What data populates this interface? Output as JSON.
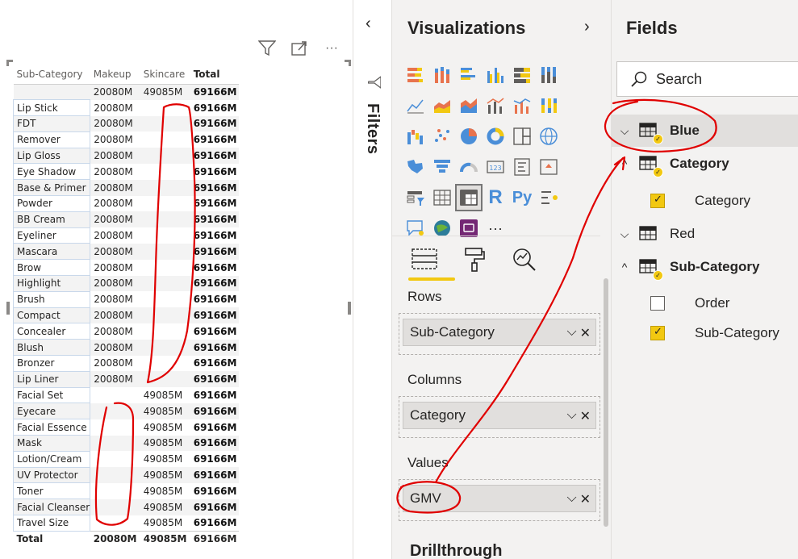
{
  "visual_header": {
    "icons": [
      "filter-icon",
      "focus-mode-icon",
      "more-options-icon"
    ],
    "more_label": "···"
  },
  "matrix": {
    "columns": [
      "Sub-Category",
      "Makeup",
      "Skincare",
      "Total"
    ],
    "rows": [
      {
        "label": "",
        "makeup": "20080M",
        "skincare": "49085M",
        "total": "69166M"
      },
      {
        "label": "Lip Stick",
        "makeup": "20080M",
        "skincare": "",
        "total": "69166M"
      },
      {
        "label": "FDT",
        "makeup": "20080M",
        "skincare": "",
        "total": "69166M"
      },
      {
        "label": "Remover",
        "makeup": "20080M",
        "skincare": "",
        "total": "69166M"
      },
      {
        "label": "Lip Gloss",
        "makeup": "20080M",
        "skincare": "",
        "total": "69166M"
      },
      {
        "label": "Eye Shadow",
        "makeup": "20080M",
        "skincare": "",
        "total": "69166M"
      },
      {
        "label": "Base & Primer",
        "makeup": "20080M",
        "skincare": "",
        "total": "69166M"
      },
      {
        "label": "Powder",
        "makeup": "20080M",
        "skincare": "",
        "total": "69166M"
      },
      {
        "label": "BB Cream",
        "makeup": "20080M",
        "skincare": "",
        "total": "69166M"
      },
      {
        "label": "Eyeliner",
        "makeup": "20080M",
        "skincare": "",
        "total": "69166M"
      },
      {
        "label": "Mascara",
        "makeup": "20080M",
        "skincare": "",
        "total": "69166M"
      },
      {
        "label": "Brow",
        "makeup": "20080M",
        "skincare": "",
        "total": "69166M"
      },
      {
        "label": "Highlight",
        "makeup": "20080M",
        "skincare": "",
        "total": "69166M"
      },
      {
        "label": "Brush",
        "makeup": "20080M",
        "skincare": "",
        "total": "69166M"
      },
      {
        "label": "Compact",
        "makeup": "20080M",
        "skincare": "",
        "total": "69166M"
      },
      {
        "label": "Concealer",
        "makeup": "20080M",
        "skincare": "",
        "total": "69166M"
      },
      {
        "label": "Blush",
        "makeup": "20080M",
        "skincare": "",
        "total": "69166M"
      },
      {
        "label": "Bronzer",
        "makeup": "20080M",
        "skincare": "",
        "total": "69166M"
      },
      {
        "label": "Lip Liner",
        "makeup": "20080M",
        "skincare": "",
        "total": "69166M"
      },
      {
        "label": "Facial Set",
        "makeup": "",
        "skincare": "49085M",
        "total": "69166M"
      },
      {
        "label": "Eyecare",
        "makeup": "",
        "skincare": "49085M",
        "total": "69166M"
      },
      {
        "label": "Facial Essence",
        "makeup": "",
        "skincare": "49085M",
        "total": "69166M"
      },
      {
        "label": "Mask",
        "makeup": "",
        "skincare": "49085M",
        "total": "69166M"
      },
      {
        "label": "Lotion/Cream",
        "makeup": "",
        "skincare": "49085M",
        "total": "69166M"
      },
      {
        "label": "UV Protector",
        "makeup": "",
        "skincare": "49085M",
        "total": "69166M"
      },
      {
        "label": "Toner",
        "makeup": "",
        "skincare": "49085M",
        "total": "69166M"
      },
      {
        "label": "Facial Cleanser",
        "makeup": "",
        "skincare": "49085M",
        "total": "69166M"
      },
      {
        "label": "Travel Size",
        "makeup": "",
        "skincare": "49085M",
        "total": "69166M"
      }
    ],
    "grand_total": {
      "label": "Total",
      "makeup": "20080M",
      "skincare": "49085M",
      "total": "69166M"
    }
  },
  "filters": {
    "label": "Filters",
    "collapse_glyph": "‹"
  },
  "visualizations": {
    "title": "Visualizations",
    "expand_glyph": "›",
    "more_label": "···",
    "r_label": "R",
    "py_label": "Py",
    "wells": {
      "rows_label": "Rows",
      "rows_field": "Sub-Category",
      "columns_label": "Columns",
      "columns_field": "Category",
      "values_label": "Values",
      "values_field": "GMV"
    },
    "drillthrough_label": "Drillthrough"
  },
  "fields": {
    "title": "Fields",
    "search_placeholder": "Search",
    "tables": [
      {
        "name": "Blue",
        "expanded": false,
        "has_selected": true
      },
      {
        "name": "Category",
        "expanded": true,
        "has_selected": true
      },
      {
        "name": "Red",
        "expanded": false,
        "has_selected": false
      },
      {
        "name": "Sub-Category",
        "expanded": true,
        "has_selected": true
      }
    ],
    "category_fields": [
      {
        "name": "Category",
        "checked": true
      }
    ],
    "subcategory_fields": [
      {
        "name": "Order",
        "checked": false
      },
      {
        "name": "Sub-Category",
        "checked": true
      }
    ]
  },
  "colors": {
    "accent_yellow": "#f2c811",
    "annotation_red": "#e00000",
    "pane_bg": "#f3f2f1"
  }
}
